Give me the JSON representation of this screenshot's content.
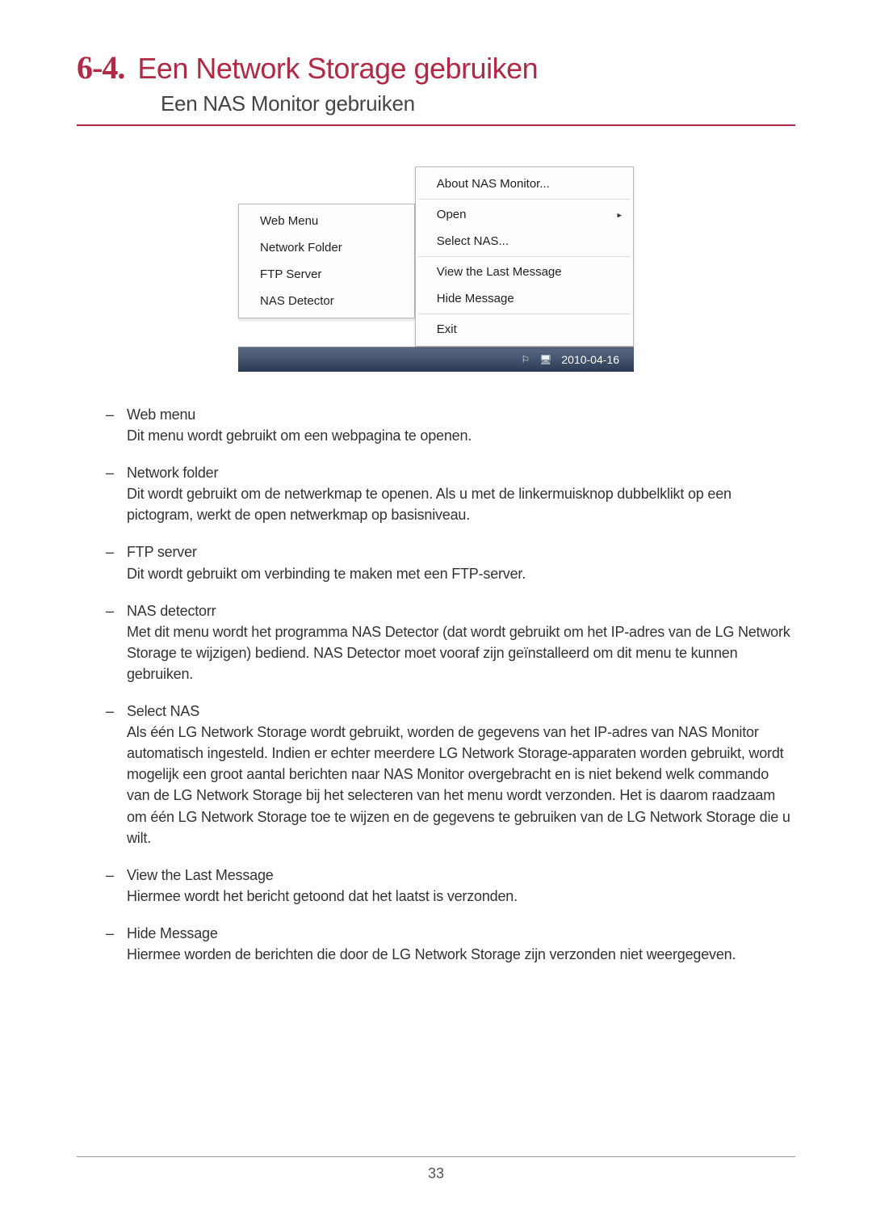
{
  "header": {
    "number": "6-4.",
    "title": "Een Network Storage gebruiken",
    "subtitle": "Een NAS Monitor gebruiken"
  },
  "figure": {
    "submenu": {
      "items": [
        "Web Menu",
        "Network Folder",
        "FTP Server",
        "NAS Detector"
      ]
    },
    "contextmenu": {
      "group1": [
        "About NAS Monitor..."
      ],
      "group2_arrow": "Open",
      "group2_rest": [
        "Select NAS..."
      ],
      "group3": [
        "View the Last Message",
        "Hide Message"
      ],
      "group4": [
        "Exit"
      ]
    },
    "taskbar_date": "2010-04-16"
  },
  "descriptions": [
    {
      "term": "Web menu",
      "body": "Dit menu wordt gebruikt om een webpagina te openen."
    },
    {
      "term": "Network folder",
      "body": "Dit wordt gebruikt om de netwerkmap te openen. Als u met de linkermuisknop dubbelklikt op een pictogram, werkt de open netwerkmap op basisniveau."
    },
    {
      "term": "FTP server",
      "body": "Dit wordt gebruikt om verbinding te maken met een FTP-server."
    },
    {
      "term": "NAS detectorr",
      "body": "Met dit menu wordt het programma NAS Detector (dat wordt gebruikt om het IP-adres van de LG Network Storage te wijzigen) bediend. NAS Detector moet vooraf zijn geïnstalleerd om dit menu te kunnen gebruiken."
    },
    {
      "term": "Select NAS",
      "body": "Als één LG Network Storage wordt gebruikt, worden de gegevens van het IP-adres van NAS Monitor automatisch ingesteld. Indien er echter meerdere LG Network Storage-apparaten worden gebruikt, wordt mogelijk een groot aantal berichten naar NAS Monitor overgebracht en is niet bekend welk commando van de LG Network Storage bij het selecteren van het menu wordt verzonden. Het is daarom raadzaam om één LG Network Storage toe te wijzen en de gegevens te gebruiken van de LG Network Storage die u wilt."
    },
    {
      "term": "View the Last Message",
      "body": "Hiermee wordt het bericht getoond dat het laatst is verzonden."
    },
    {
      "term": "Hide Message",
      "body": "Hiermee worden de berichten die door de LG Network Storage zijn verzonden niet weergegeven."
    }
  ],
  "page_number": "33"
}
